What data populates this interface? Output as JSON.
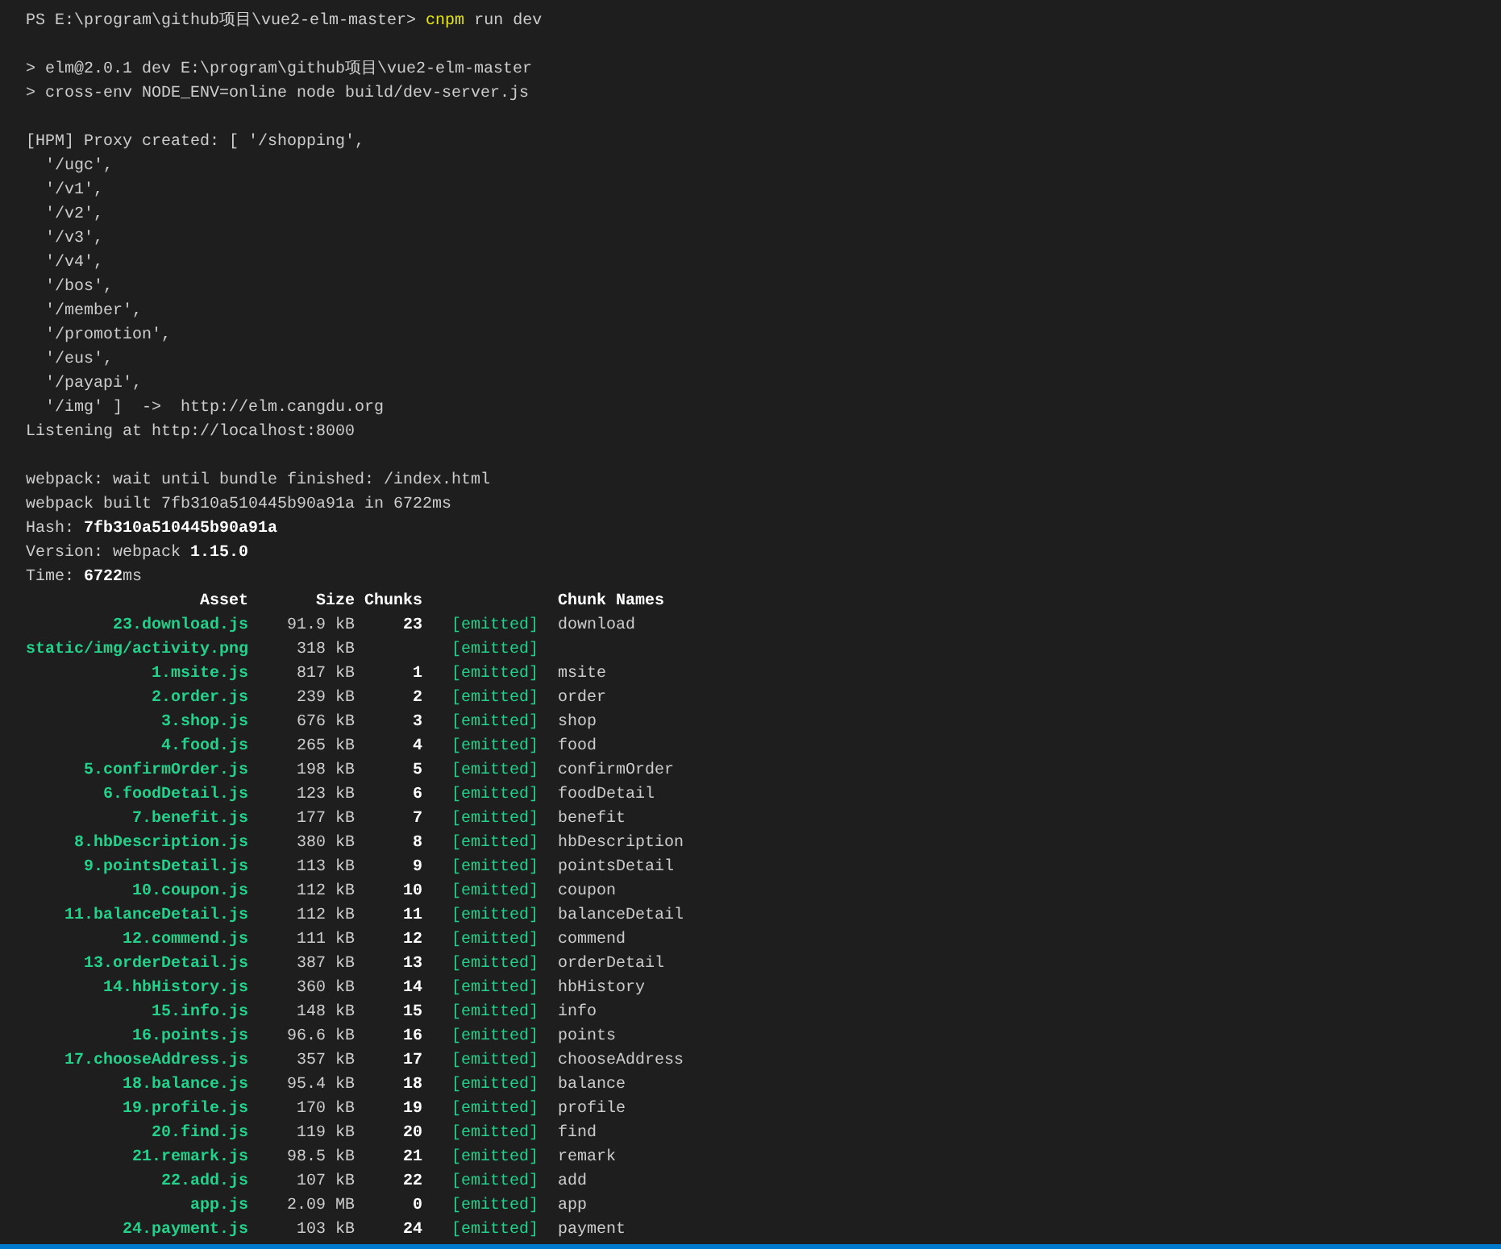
{
  "lines": [
    {
      "kind": "prompt",
      "prompt": "PS E:\\program\\github项目\\vue2-elm-master>",
      "command": "cnpm",
      "args": "run dev"
    },
    {
      "kind": "blank"
    },
    {
      "kind": "text",
      "text": "> elm@2.0.1 dev E:\\program\\github项目\\vue2-elm-master"
    },
    {
      "kind": "text",
      "text": "> cross-env NODE_ENV=online node build/dev-server.js"
    },
    {
      "kind": "blank"
    },
    {
      "kind": "text",
      "text": "[HPM] Proxy created: [ '/shopping',"
    },
    {
      "kind": "text",
      "text": "  '/ugc',"
    },
    {
      "kind": "text",
      "text": "  '/v1',"
    },
    {
      "kind": "text",
      "text": "  '/v2',"
    },
    {
      "kind": "text",
      "text": "  '/v3',"
    },
    {
      "kind": "text",
      "text": "  '/v4',"
    },
    {
      "kind": "text",
      "text": "  '/bos',"
    },
    {
      "kind": "text",
      "text": "  '/member',"
    },
    {
      "kind": "text",
      "text": "  '/promotion',"
    },
    {
      "kind": "text",
      "text": "  '/eus',"
    },
    {
      "kind": "text",
      "text": "  '/payapi',"
    },
    {
      "kind": "text",
      "text": "  '/img' ]  ->  http://elm.cangdu.org"
    },
    {
      "kind": "text",
      "text": "Listening at http://localhost:8000"
    },
    {
      "kind": "blank"
    },
    {
      "kind": "text",
      "text": "webpack: wait until bundle finished: /index.html"
    },
    {
      "kind": "text",
      "text": "webpack built 7fb310a510445b90a91a in 6722ms"
    },
    {
      "kind": "text",
      "text": "Hash: **7fb310a510445b90a91a**"
    },
    {
      "kind": "text",
      "text": "Version: webpack **1.15.0**"
    },
    {
      "kind": "text",
      "text": "Time: **6722**ms"
    }
  ],
  "table": {
    "columns": [
      "Asset",
      "Size",
      "Chunks",
      "Chunk Names"
    ],
    "rows": [
      {
        "asset": "23.download.js",
        "size": "91.9 kB",
        "chunks": "23",
        "status": "[emitted]",
        "name": "download"
      },
      {
        "asset": "static/img/activity.png",
        "size": "318 kB",
        "status": "[emitted]"
      },
      {
        "asset": "1.msite.js",
        "size": "817 kB",
        "chunks": "1",
        "status": "[emitted]",
        "name": "msite"
      },
      {
        "asset": "2.order.js",
        "size": "239 kB",
        "chunks": "2",
        "status": "[emitted]",
        "name": "order"
      },
      {
        "asset": "3.shop.js",
        "size": "676 kB",
        "chunks": "3",
        "status": "[emitted]",
        "name": "shop"
      },
      {
        "asset": "4.food.js",
        "size": "265 kB",
        "chunks": "4",
        "status": "[emitted]",
        "name": "food"
      },
      {
        "asset": "5.confirmOrder.js",
        "size": "198 kB",
        "chunks": "5",
        "status": "[emitted]",
        "name": "confirmOrder"
      },
      {
        "asset": "6.foodDetail.js",
        "size": "123 kB",
        "chunks": "6",
        "status": "[emitted]",
        "name": "foodDetail"
      },
      {
        "asset": "7.benefit.js",
        "size": "177 kB",
        "chunks": "7",
        "status": "[emitted]",
        "name": "benefit"
      },
      {
        "asset": "8.hbDescription.js",
        "size": "380 kB",
        "chunks": "8",
        "status": "[emitted]",
        "name": "hbDescription"
      },
      {
        "asset": "9.pointsDetail.js",
        "size": "113 kB",
        "chunks": "9",
        "status": "[emitted]",
        "name": "pointsDetail"
      },
      {
        "asset": "10.coupon.js",
        "size": "112 kB",
        "chunks": "10",
        "status": "[emitted]",
        "name": "coupon"
      },
      {
        "asset": "11.balanceDetail.js",
        "size": "112 kB",
        "chunks": "11",
        "status": "[emitted]",
        "name": "balanceDetail"
      },
      {
        "asset": "12.commend.js",
        "size": "111 kB",
        "chunks": "12",
        "status": "[emitted]",
        "name": "commend"
      },
      {
        "asset": "13.orderDetail.js",
        "size": "387 kB",
        "chunks": "13",
        "status": "[emitted]",
        "name": "orderDetail"
      },
      {
        "asset": "14.hbHistory.js",
        "size": "360 kB",
        "chunks": "14",
        "status": "[emitted]",
        "name": "hbHistory"
      },
      {
        "asset": "15.info.js",
        "size": "148 kB",
        "chunks": "15",
        "status": "[emitted]",
        "name": "info"
      },
      {
        "asset": "16.points.js",
        "size": "96.6 kB",
        "chunks": "16",
        "status": "[emitted]",
        "name": "points"
      },
      {
        "asset": "17.chooseAddress.js",
        "size": "357 kB",
        "chunks": "17",
        "status": "[emitted]",
        "name": "chooseAddress"
      },
      {
        "asset": "18.balance.js",
        "size": "95.4 kB",
        "chunks": "18",
        "status": "[emitted]",
        "name": "balance"
      },
      {
        "asset": "19.profile.js",
        "size": "170 kB",
        "chunks": "19",
        "status": "[emitted]",
        "name": "profile"
      },
      {
        "asset": "20.find.js",
        "size": "119 kB",
        "chunks": "20",
        "status": "[emitted]",
        "name": "find"
      },
      {
        "asset": "21.remark.js",
        "size": "98.5 kB",
        "chunks": "21",
        "status": "[emitted]",
        "name": "remark"
      },
      {
        "asset": "22.add.js",
        "size": "107 kB",
        "chunks": "22",
        "status": "[emitted]",
        "name": "add"
      },
      {
        "asset": "app.js",
        "size": "2.09 MB",
        "chunks": "0",
        "status": "[emitted]",
        "name": "app"
      },
      {
        "asset": "24.payment.js",
        "size": "103 kB",
        "chunks": "24",
        "status": "[emitted]",
        "name": "payment"
      }
    ]
  }
}
